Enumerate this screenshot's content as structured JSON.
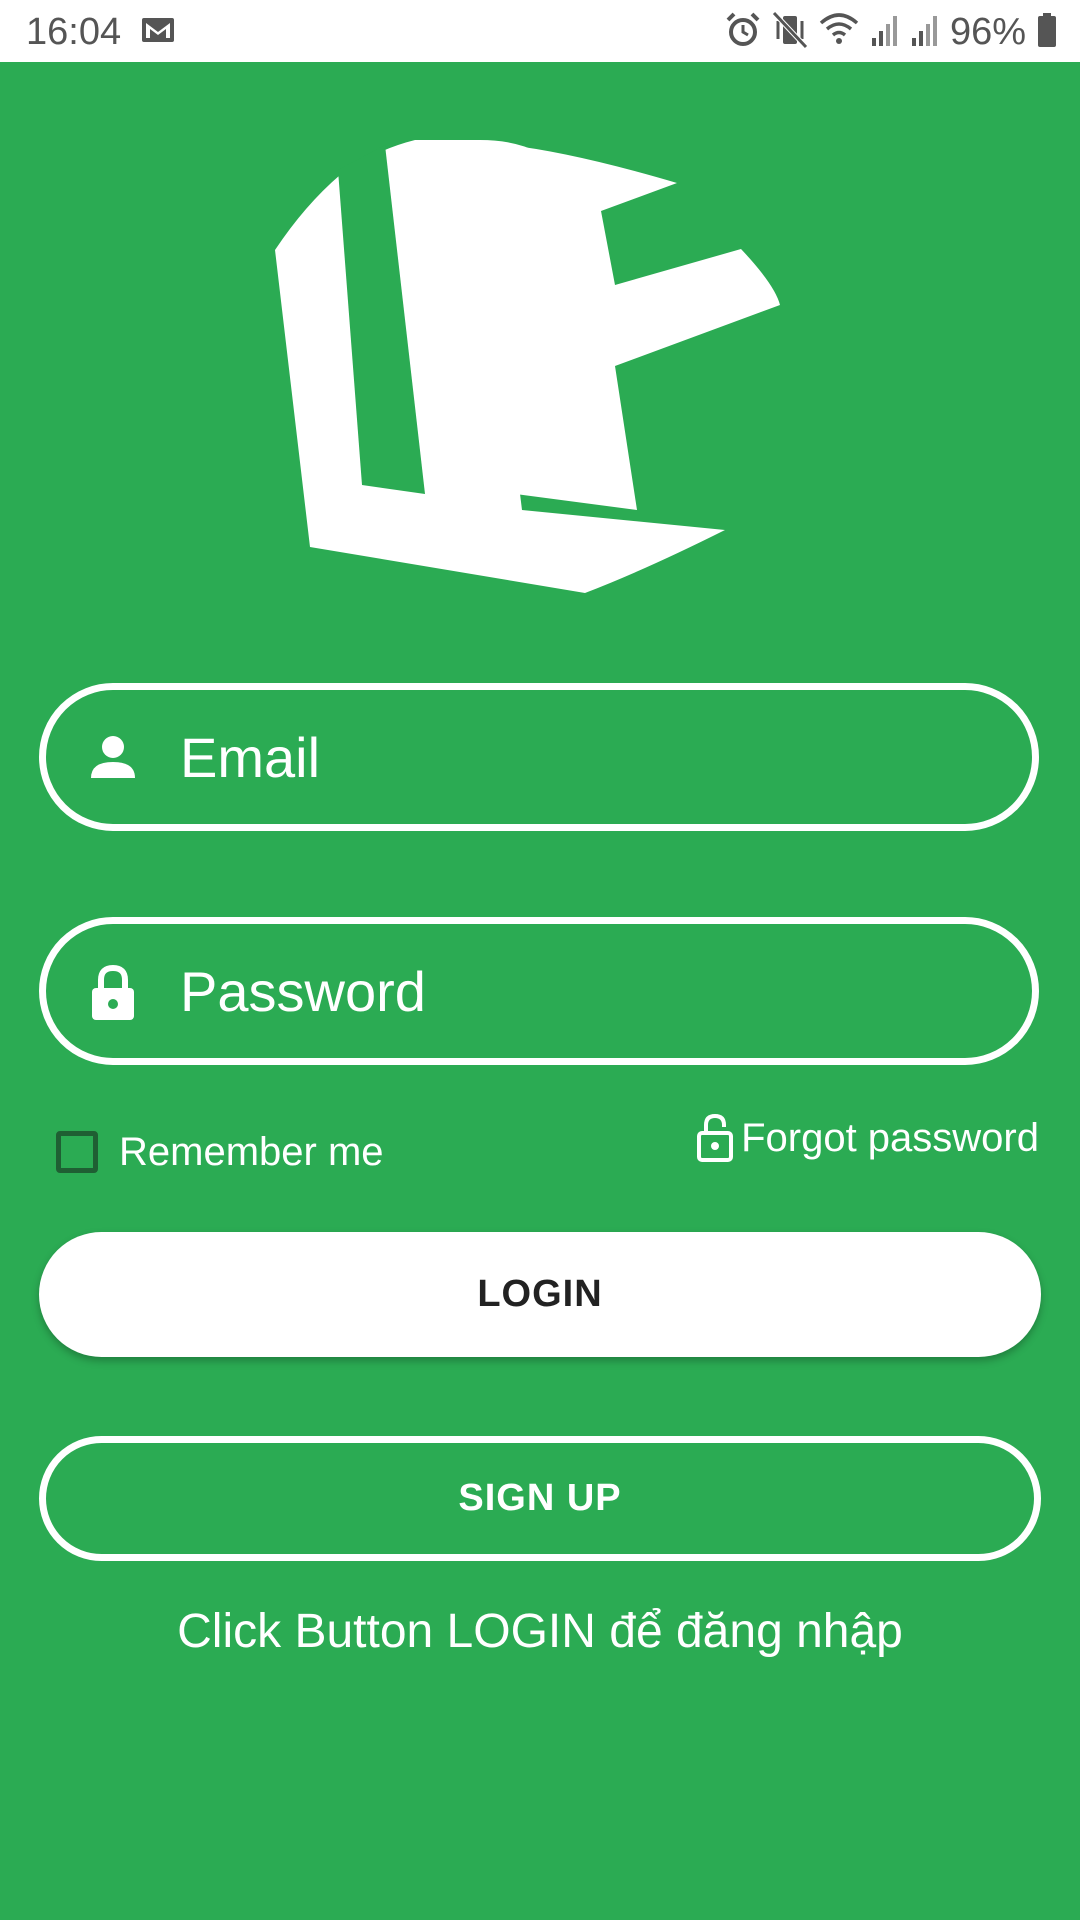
{
  "status_bar": {
    "time": "16:04",
    "battery": "96%",
    "icons": [
      "gmail-icon",
      "alarm-icon",
      "vibrate-icon",
      "wifi-icon",
      "signal-icon",
      "signal-icon",
      "battery-icon"
    ]
  },
  "logo": {
    "icon": "lf-logo"
  },
  "form": {
    "email_placeholder": "Email",
    "password_placeholder": "Password",
    "email_icon": "person-icon",
    "password_icon": "lock-icon"
  },
  "remember": {
    "label": "Remember me",
    "checked": false
  },
  "forgot": {
    "label": "Forgot password",
    "icon": "unlock-icon"
  },
  "buttons": {
    "login": "LOGIN",
    "signup": "SIGN UP"
  },
  "hint": "Click Button LOGIN để đăng nhập",
  "colors": {
    "background": "#2bab53",
    "foreground": "#ffffff",
    "checkbox_border": "#1f5f33"
  }
}
